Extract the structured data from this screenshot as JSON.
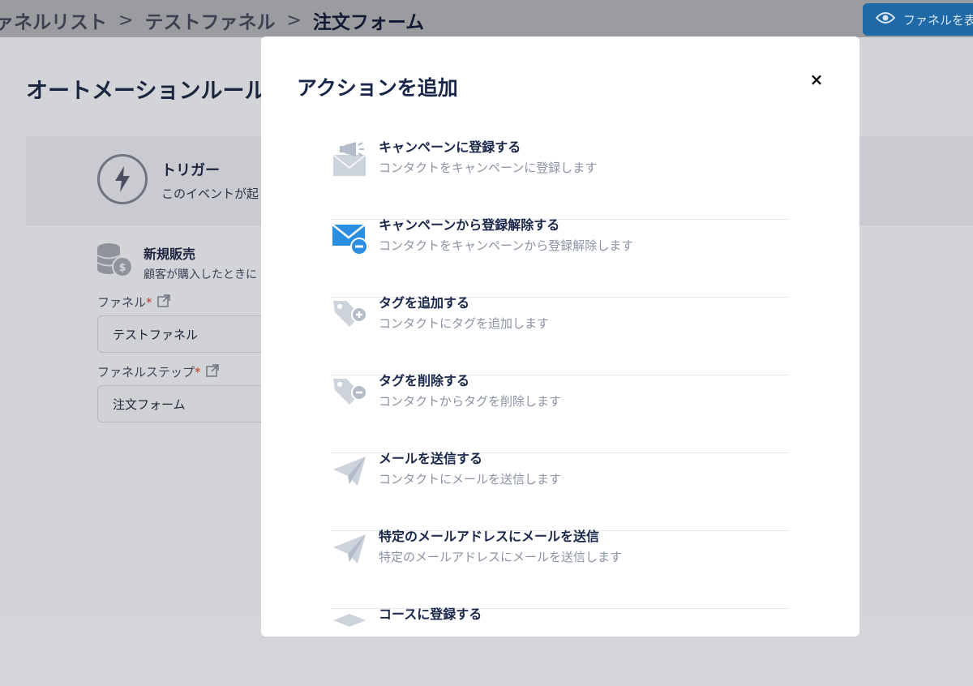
{
  "breadcrumb": {
    "items": [
      "ァネルリスト",
      "テストファネル",
      "注文フォーム"
    ],
    "separator": ">"
  },
  "header": {
    "preview_label": "ファネルを表"
  },
  "page": {
    "title": "オートメーションルール",
    "trigger": {
      "title": "トリガー",
      "subtitle": "このイベントが起"
    },
    "sale": {
      "title": "新規販売",
      "subtitle": "顧客が購入したときに"
    },
    "fields": {
      "funnel_label": "ファネル",
      "funnel_value": "テストファネル",
      "step_label": "ファネルステップ",
      "step_value": "注文フォーム",
      "required_mark": "*"
    }
  },
  "modal": {
    "title": "アクションを追加",
    "close_label": "×",
    "actions": [
      {
        "icon": "megaphone-envelope-icon",
        "title": "キャンペーンに登録する",
        "description": "コンタクトをキャンペーンに登録します"
      },
      {
        "icon": "envelope-minus-icon",
        "title": "キャンペーンから登録解除する",
        "description": "コンタクトをキャンペーンから登録解除します"
      },
      {
        "icon": "tag-plus-icon",
        "title": "タグを追加する",
        "description": "コンタクトにタグを追加します"
      },
      {
        "icon": "tag-minus-icon",
        "title": "タグを削除する",
        "description": "コンタクトからタグを削除します"
      },
      {
        "icon": "paper-plane-icon",
        "title": "メールを送信する",
        "description": "コンタクトにメールを送信します"
      },
      {
        "icon": "paper-plane-icon",
        "title": "特定のメールアドレスにメールを送信",
        "description": "特定のメールアドレスにメールを送信します"
      },
      {
        "icon": "graduation-cap-icon",
        "title": "コースに登録する",
        "description": ""
      }
    ]
  },
  "colors": {
    "accent": "#2a8fe0",
    "title_text": "#18264a",
    "muted_text": "#8a93a3",
    "icon_gray": "#b9c1cc"
  }
}
